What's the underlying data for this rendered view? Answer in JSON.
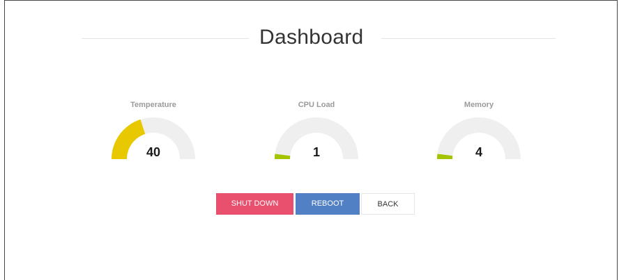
{
  "page": {
    "title": "Dashboard"
  },
  "gauges": [
    {
      "label": "Temperature",
      "value": "40",
      "fraction": 0.4,
      "color": "#e8c800"
    },
    {
      "label": "CPU Load",
      "value": "1",
      "fraction": 0.01,
      "color": "#a4c400"
    },
    {
      "label": "Memory",
      "value": "4",
      "fraction": 0.04,
      "color": "#a4c400"
    }
  ],
  "colors": {
    "track": "#efefef",
    "shutdown": "#e8506e",
    "reboot": "#5280c4"
  },
  "buttons": {
    "shutdown": "SHUT DOWN",
    "reboot": "REBOOT",
    "back": "BACK"
  }
}
